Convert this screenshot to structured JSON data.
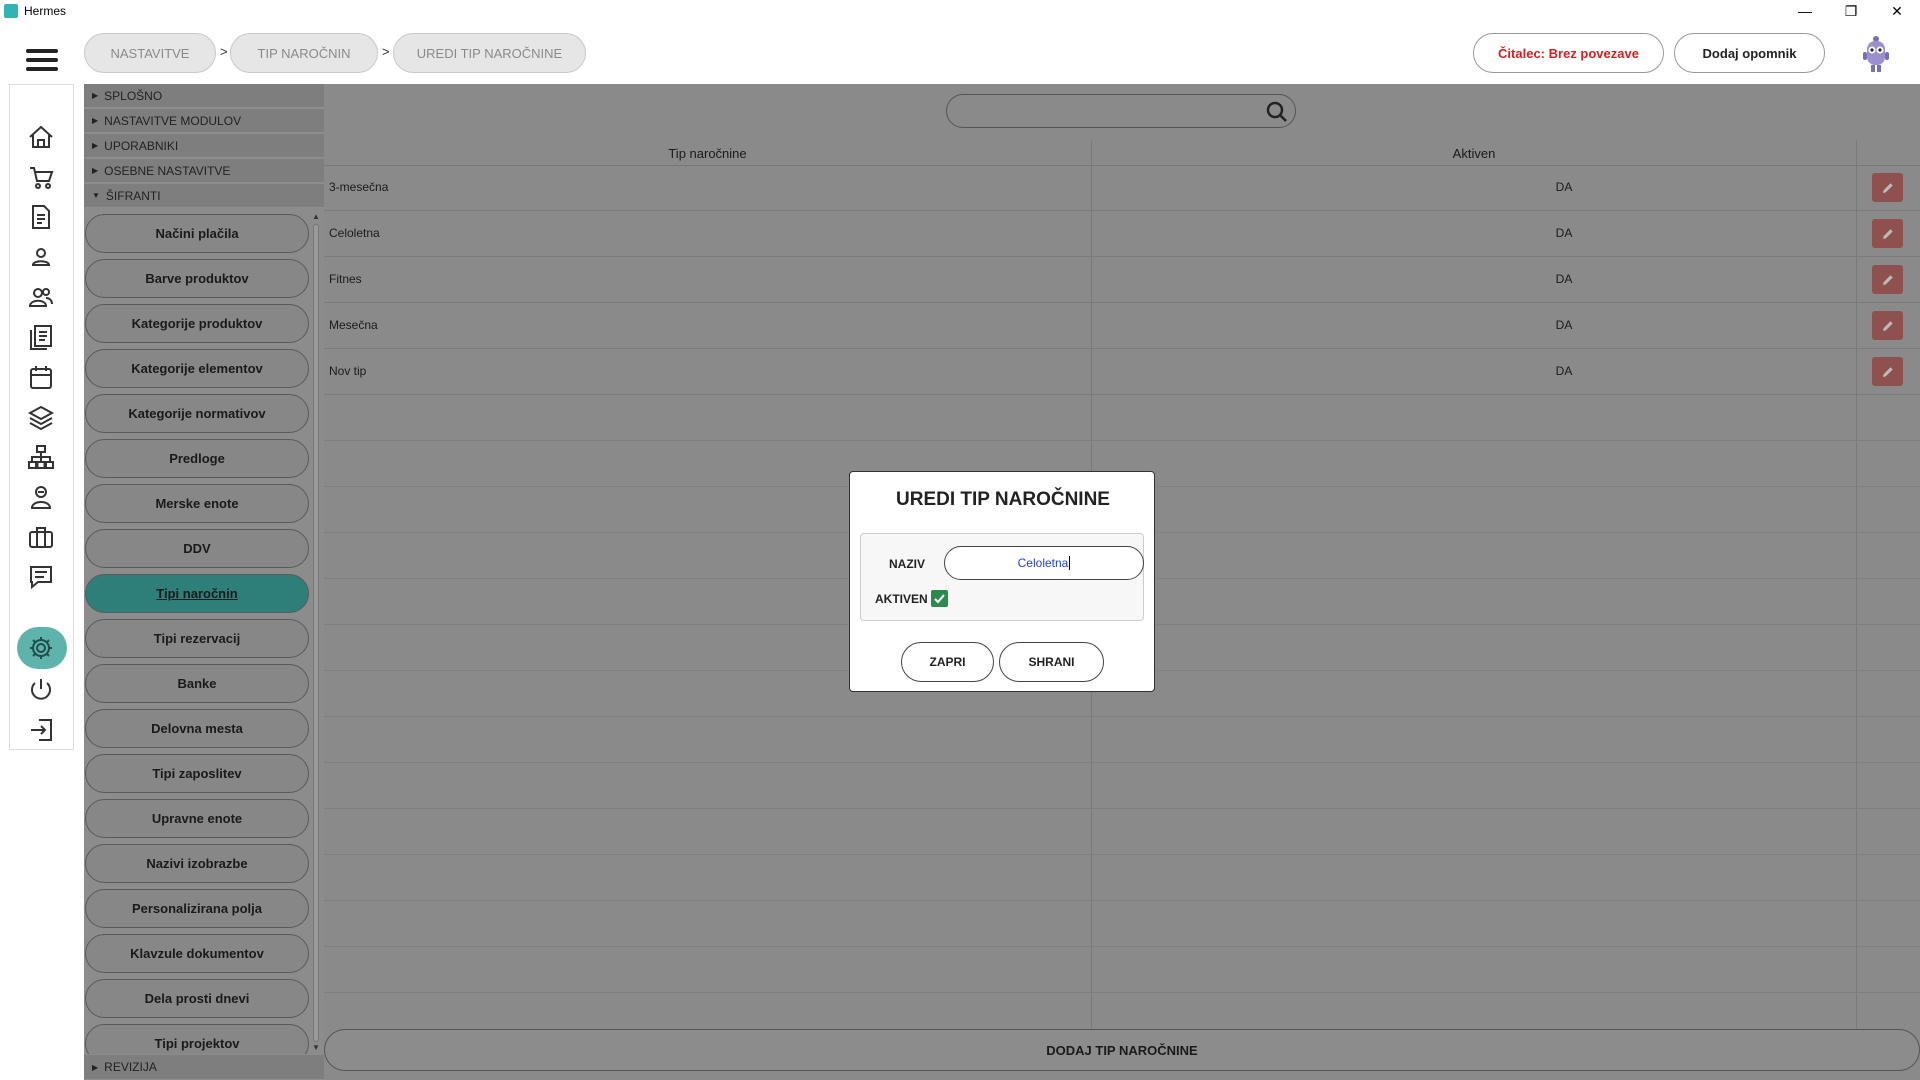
{
  "window": {
    "title": "Hermes",
    "controls": [
      "—",
      "❐",
      "✕"
    ]
  },
  "breadcrumb": [
    "NASTAVITVE",
    "TIP NAROČNIN",
    "UREDI TIP NAROČNINE"
  ],
  "breadcrumb_separator": ">",
  "header": {
    "reader_status": "Čitalec: Brez povezave",
    "add_reminder": "Dodaj opomnik"
  },
  "sections": {
    "general": "SPLOŠNO",
    "modules": "NASTAVITVE MODULOV",
    "users": "UPORABNIKI",
    "personal": "OSEBNE NASTAVITVE",
    "codebooks": "ŠIFRANTI",
    "revision": "REVIZIJA"
  },
  "menu_items": [
    "Načini plačila",
    "Barve produktov",
    "Kategorije produktov",
    "Kategorije elementov",
    "Kategorije normativov",
    "Predloge",
    "Merske enote",
    "DDV",
    "Tipi naročnin",
    "Tipi rezervacij",
    "Banke",
    "Delovna mesta",
    "Tipi zaposlitev",
    "Upravne enote",
    "Nazivi izobrazbe",
    "Personalizirana polja",
    "Klavzule dokumentov",
    "Dela prosti dnevi",
    "Tipi projektov"
  ],
  "active_menu_item": "Tipi naročnin",
  "search": {
    "value": "",
    "placeholder": ""
  },
  "table": {
    "columns": [
      "Tip naročnine",
      "Aktiven"
    ],
    "rows": [
      {
        "name": "3-mesečna",
        "active": "DA"
      },
      {
        "name": "Celoletna",
        "active": "DA"
      },
      {
        "name": "Fitnes",
        "active": "DA"
      },
      {
        "name": "Mesečna",
        "active": "DA"
      },
      {
        "name": "Nov tip",
        "active": "DA"
      }
    ]
  },
  "add_button": "DODAJ TIP NAROČNINE",
  "modal": {
    "title": "UREDI TIP NAROČNINE",
    "name_label": "NAZIV",
    "name_value": "Celoletna",
    "active_label": "AKTIVEN",
    "active_checked": true,
    "close_label": "ZAPRI",
    "save_label": "SHRANI"
  },
  "colors": {
    "accent": "#2e7f79",
    "rail_active": "#5fb3ad",
    "reader_status": "#d32020",
    "edit_button": "#8f5150",
    "checkbox": "#2c8a4f",
    "input_text": "#1f3fd6"
  },
  "icons": {
    "rail": [
      "home-icon",
      "cart-icon",
      "document-icon",
      "user-icon",
      "users-icon",
      "pages-icon",
      "calendar-icon",
      "layers-icon",
      "hierarchy-icon",
      "trainer-icon",
      "briefcase-icon",
      "chat-icon",
      "gear-icon",
      "power-icon",
      "logout-icon"
    ]
  }
}
